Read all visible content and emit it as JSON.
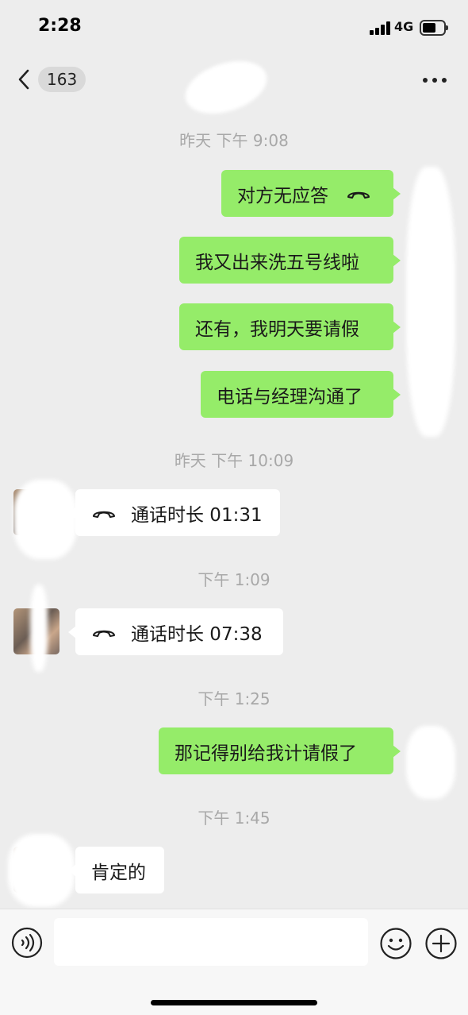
{
  "status_bar": {
    "time": "2:28",
    "network": "4G",
    "battery_level": 0.55
  },
  "nav": {
    "back_count": "163"
  },
  "messages": [
    {
      "type": "timestamp",
      "text": "昨天 下午 9:08"
    },
    {
      "type": "out",
      "text": "对方无应答",
      "icon": "phone-icon"
    },
    {
      "type": "out",
      "text": "我又出来洗五号线啦"
    },
    {
      "type": "out",
      "text": "还有，我明天要请假"
    },
    {
      "type": "out",
      "text": "电话与经理沟通了"
    },
    {
      "type": "timestamp",
      "text": "昨天 下午 10:09"
    },
    {
      "type": "in",
      "text": "通话时长 01:31",
      "icon": "phone-icon"
    },
    {
      "type": "timestamp",
      "text": "下午 1:09"
    },
    {
      "type": "in",
      "text": "通话时长 07:38",
      "icon": "phone-icon"
    },
    {
      "type": "timestamp",
      "text": "下午 1:25"
    },
    {
      "type": "out",
      "text": "那记得别给我计请假了"
    },
    {
      "type": "timestamp",
      "text": "下午 1:45"
    },
    {
      "type": "in",
      "text": "肯定的"
    }
  ],
  "input": {
    "placeholder": "",
    "value": ""
  },
  "colors": {
    "background": "#ededed",
    "outgoing_bubble": "#95ec69",
    "incoming_bubble": "#ffffff",
    "timestamp": "#a8a8a8"
  }
}
